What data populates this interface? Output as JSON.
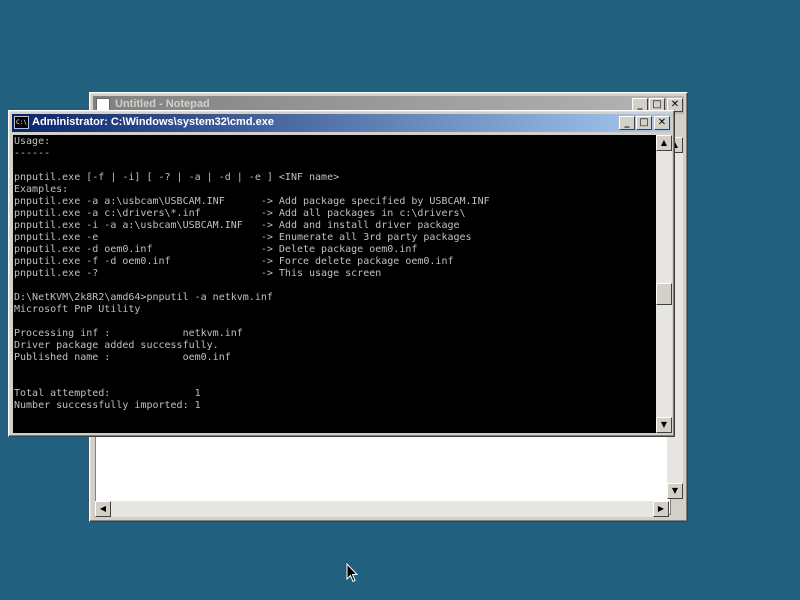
{
  "notepad": {
    "title": "Untitled - Notepad",
    "buttons": {
      "minimize": "_",
      "maximize": "□",
      "close": "✕"
    }
  },
  "cmd": {
    "icon_text": "C:\\",
    "title": "Administrator: C:\\Windows\\system32\\cmd.exe",
    "buttons": {
      "minimize": "_",
      "maximize": "□",
      "close": "✕"
    },
    "console_lines": [
      "Usage:",
      "------",
      "",
      "pnputil.exe [-f | -i] [ -? | -a | -d | -e ] <INF name>",
      "Examples:",
      "pnputil.exe -a a:\\usbcam\\USBCAM.INF      -> Add package specified by USBCAM.INF",
      "pnputil.exe -a c:\\drivers\\*.inf          -> Add all packages in c:\\drivers\\",
      "pnputil.exe -i -a a:\\usbcam\\USBCAM.INF   -> Add and install driver package",
      "pnputil.exe -e                           -> Enumerate all 3rd party packages",
      "pnputil.exe -d oem0.inf                  -> Delete package oem0.inf",
      "pnputil.exe -f -d oem0.inf               -> Force delete package oem0.inf",
      "pnputil.exe -?                           -> This usage screen",
      "",
      "D:\\NetKVM\\2k8R2\\amd64>pnputil -a netkvm.inf",
      "Microsoft PnP Utility",
      "",
      "Processing inf :            netkvm.inf",
      "Driver package added successfully.",
      "Published name :            oem0.inf",
      "",
      "",
      "Total attempted:              1",
      "Number successfully imported: 1",
      "",
      ""
    ],
    "prompt": "D:\\NetKVM\\2k8R2\\amd64>"
  }
}
